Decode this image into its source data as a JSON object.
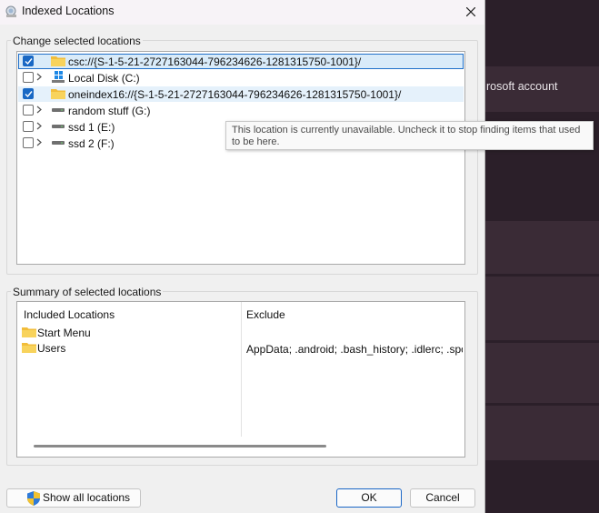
{
  "window": {
    "title": "Indexed Locations"
  },
  "locations": {
    "group_label": "Change selected locations",
    "items": [
      {
        "label": "csc://{S-1-5-21-2727163044-796234626-1281315750-1001}/",
        "checked": true,
        "expandable": false,
        "icon": "folder-icon",
        "state": "selected"
      },
      {
        "label": "Local Disk (C:)",
        "checked": false,
        "expandable": true,
        "icon": "windows-drive-icon",
        "state": "normal"
      },
      {
        "label": "oneindex16://{S-1-5-21-2727163044-796234626-1281315750-1001}/",
        "checked": true,
        "expandable": false,
        "icon": "folder-icon",
        "state": "hover"
      },
      {
        "label": "random stuff (G:)",
        "checked": false,
        "expandable": true,
        "icon": "drive-icon",
        "state": "normal"
      },
      {
        "label": "ssd 1 (E:)",
        "checked": false,
        "expandable": true,
        "icon": "drive-icon",
        "state": "normal"
      },
      {
        "label": "ssd 2 (F:)",
        "checked": false,
        "expandable": true,
        "icon": "drive-icon",
        "state": "normal"
      }
    ]
  },
  "tooltip": {
    "text": "This location is currently unavailable. Uncheck it to stop finding items that used to be here."
  },
  "summary": {
    "group_label": "Summary of selected locations",
    "included_header": "Included Locations",
    "exclude_header": "Exclude",
    "included": [
      {
        "label": "Start Menu",
        "exclude": ""
      },
      {
        "label": "Users",
        "exclude": "AppData; .android; .bash_history; .idlerc; .spotdl"
      }
    ]
  },
  "buttons": {
    "show_all": "Show all locations",
    "ok": "OK",
    "cancel": "Cancel"
  },
  "background_app": {
    "partial_text": "rosoft account"
  },
  "colors": {
    "accent": "#1968c4",
    "selection_bg": "#d9ebf9",
    "folder": "#f4c542",
    "dialog_bg": "#f0f0f0",
    "background_app": "#2b1f29"
  }
}
